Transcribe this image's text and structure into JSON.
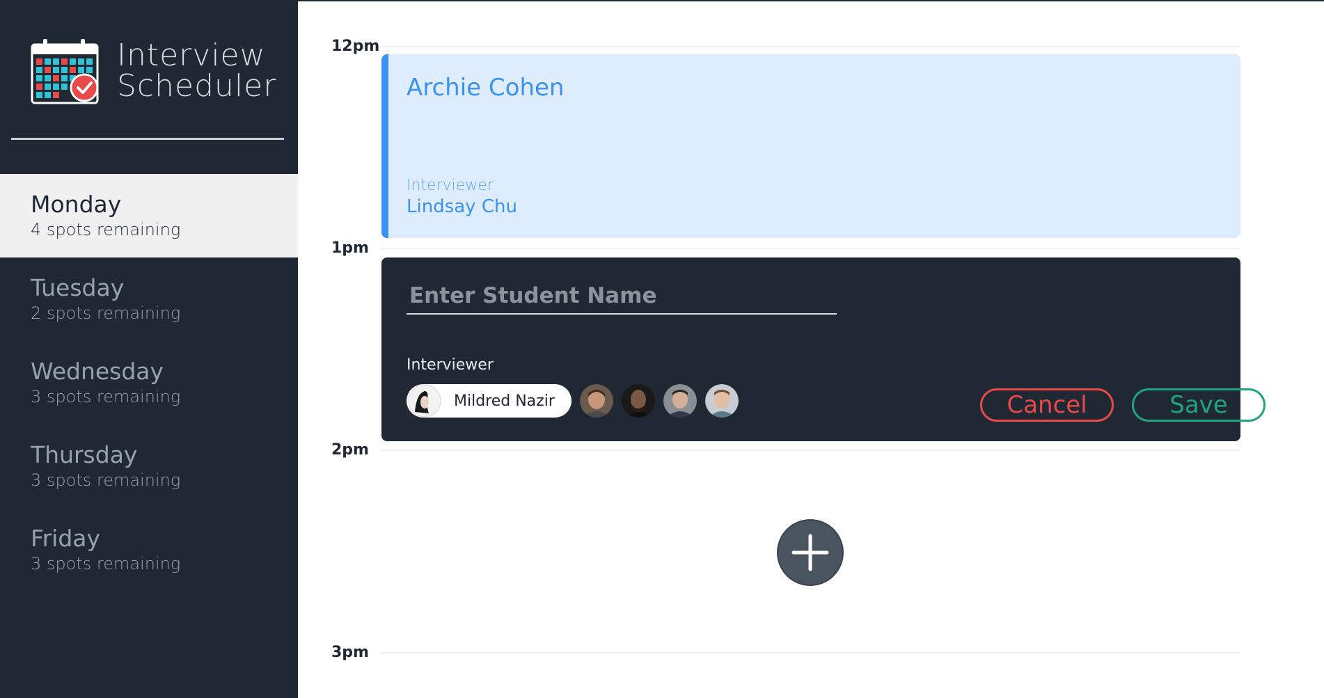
{
  "brand": {
    "title_line1": "Interview",
    "title_line2": "Scheduler",
    "logo_icon": "calendar-check-icon"
  },
  "days": [
    {
      "name": "Monday",
      "spots": "4 spots remaining",
      "selected": true
    },
    {
      "name": "Tuesday",
      "spots": "2 spots remaining",
      "selected": false
    },
    {
      "name": "Wednesday",
      "spots": "3 spots remaining",
      "selected": false
    },
    {
      "name": "Thursday",
      "spots": "3 spots remaining",
      "selected": false
    },
    {
      "name": "Friday",
      "spots": "3 spots remaining",
      "selected": false
    }
  ],
  "schedule": {
    "times": [
      "12pm",
      "1pm",
      "2pm",
      "3pm"
    ],
    "booked": {
      "student": "Archie Cohen",
      "interviewer_label": "Interviewer",
      "interviewer": "Lindsay Chu"
    },
    "form": {
      "student_placeholder": "Enter Student Name",
      "student_value": "",
      "interviewer_label": "Interviewer",
      "selected_interviewer": "Mildred Nazir",
      "other_interviewers": [
        "interviewer-avatar-2",
        "interviewer-avatar-3",
        "interviewer-avatar-4",
        "interviewer-avatar-5"
      ],
      "cancel_label": "Cancel",
      "save_label": "Save"
    },
    "add_icon": "plus-icon"
  },
  "colors": {
    "sidebar_bg": "#1f2833",
    "selected_day_bg": "#f0f0f0",
    "booked_bg": "#deedfd",
    "booked_accent": "#3d91f0",
    "cancel": "#e84a4a",
    "save": "#1fa47f",
    "add_button": "#4a545f"
  }
}
